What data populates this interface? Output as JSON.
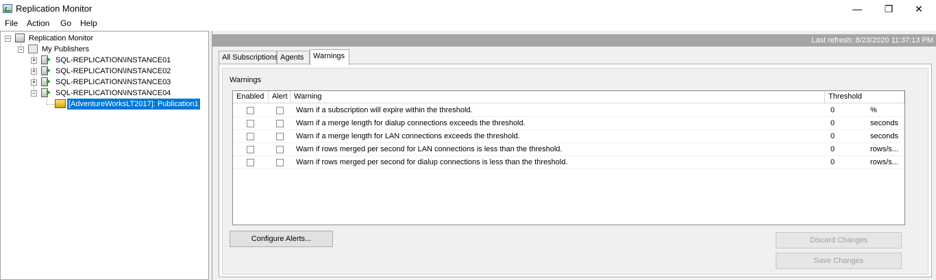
{
  "window": {
    "title": "Replication Monitor",
    "controls": {
      "minimize": "—",
      "restore": "❐",
      "close": "✕"
    }
  },
  "menu": [
    "File",
    "Action",
    "Go",
    "Help"
  ],
  "tree": {
    "root": "Replication Monitor",
    "publishers": "My Publishers",
    "instances": [
      "SQL-REPLICATION\\INSTANCE01",
      "SQL-REPLICATION\\INSTANCE02",
      "SQL-REPLICATION\\INSTANCE03",
      "SQL-REPLICATION\\INSTANCE04"
    ],
    "publication": "[AdventureWorksLT2017]: Publication1"
  },
  "status": {
    "last_refresh": "Last refresh: 8/23/2020 11:37:13 PM"
  },
  "tabs": [
    "All Subscriptions",
    "Agents",
    "Warnings"
  ],
  "active_tab": "Warnings",
  "warnings": {
    "group_label": "Warnings",
    "columns": [
      "Enabled",
      "Alert",
      "Warning",
      "Threshold"
    ],
    "rows": [
      {
        "warning": "Warn if a subscription will expire within the threshold.",
        "threshold": "0",
        "unit": "%"
      },
      {
        "warning": "Warn if a merge length for dialup connections exceeds the threshold.",
        "threshold": "0",
        "unit": "seconds"
      },
      {
        "warning": "Warn if a merge length for LAN connections exceeds the threshold.",
        "threshold": "0",
        "unit": "seconds"
      },
      {
        "warning": "Warn if rows merged per second for LAN connections is less than the threshold.",
        "threshold": "0",
        "unit": "rows/s..."
      },
      {
        "warning": "Warn if rows merged per second for dialup connections is less than the threshold.",
        "threshold": "0",
        "unit": "rows/s..."
      }
    ],
    "configure_alerts_label": "Configure Alerts...",
    "discard_label": "Discard Changes",
    "save_label": "Save Changes"
  }
}
